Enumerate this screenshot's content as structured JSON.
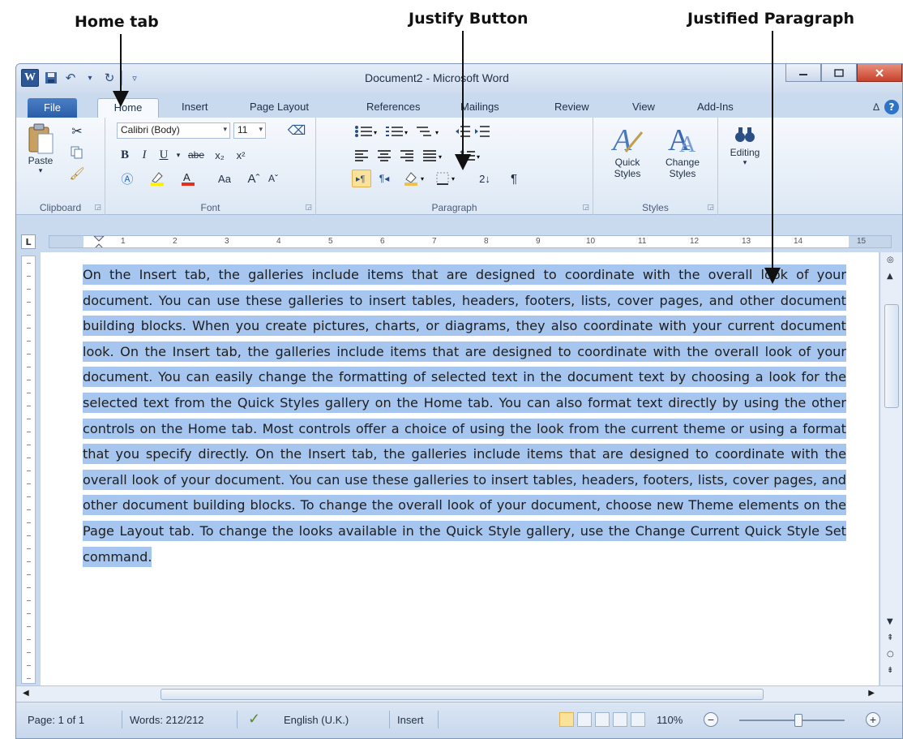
{
  "annotations": {
    "home_tab": "Home tab",
    "justify_button": "Justify Button",
    "justified_paragraph": "Justified Paragraph"
  },
  "window": {
    "title": "Document2 - Microsoft Word",
    "logo": "W"
  },
  "tabs": [
    "File",
    "Home",
    "Insert",
    "Page Layout",
    "References",
    "Mailings",
    "Review",
    "View",
    "Add-Ins"
  ],
  "ribbon": {
    "clipboard": {
      "label": "Clipboard",
      "paste": "Paste"
    },
    "font": {
      "label": "Font",
      "font_name": "Calibri (Body)",
      "font_size": "11",
      "bold": "B",
      "italic": "I",
      "underline": "U",
      "strike": "abe",
      "subscript": "x₂",
      "superscript": "x²",
      "change_case": "Aa",
      "grow": "Aˆ",
      "shrink": "Aˇ"
    },
    "paragraph": {
      "label": "Paragraph",
      "pilcrow": "¶",
      "sort": "2↓"
    },
    "styles": {
      "label": "Styles",
      "quick": "Quick\nStyles",
      "change": "Change\nStyles"
    },
    "editing": {
      "label": "Editing"
    }
  },
  "ruler": [
    "1",
    "2",
    "3",
    "4",
    "5",
    "6",
    "7",
    "8",
    "9",
    "10",
    "11",
    "12",
    "13",
    "14",
    "15"
  ],
  "document": {
    "text": "On the Insert tab, the galleries include items that are designed to coordinate with the overall look of your document. You can use these galleries to insert tables, headers, footers, lists, cover pages, and other document building blocks. When you create pictures, charts, or diagrams, they also coordinate with your current document look. On the Insert tab, the galleries include items that are designed to coordinate with the overall look of your document. You can easily change the formatting of selected text in the document text by choosing a look for the selected text from the Quick Styles gallery on the Home tab. You can also format text directly by using the other controls on the Home tab. Most controls offer a choice of using the look from the current theme or using a format that you specify directly. On the Insert tab, the galleries include items that are designed to coordinate with the overall look of your document. You can use these galleries to insert tables, headers, footers, lists, cover pages, and other document building blocks. To change the overall look of your document, choose new Theme elements on the Page Layout tab. To change the looks available in the Quick Style gallery, use the Change Current Quick Style Set command."
  },
  "status": {
    "page": "Page: 1 of 1",
    "words": "Words: 212/212",
    "language": "English (U.K.)",
    "mode": "Insert",
    "zoom": "110%"
  },
  "colors": {
    "selection": "#a6c6ef",
    "file_tab": "#2a5da8",
    "active_highlight": "#fbe29a"
  }
}
